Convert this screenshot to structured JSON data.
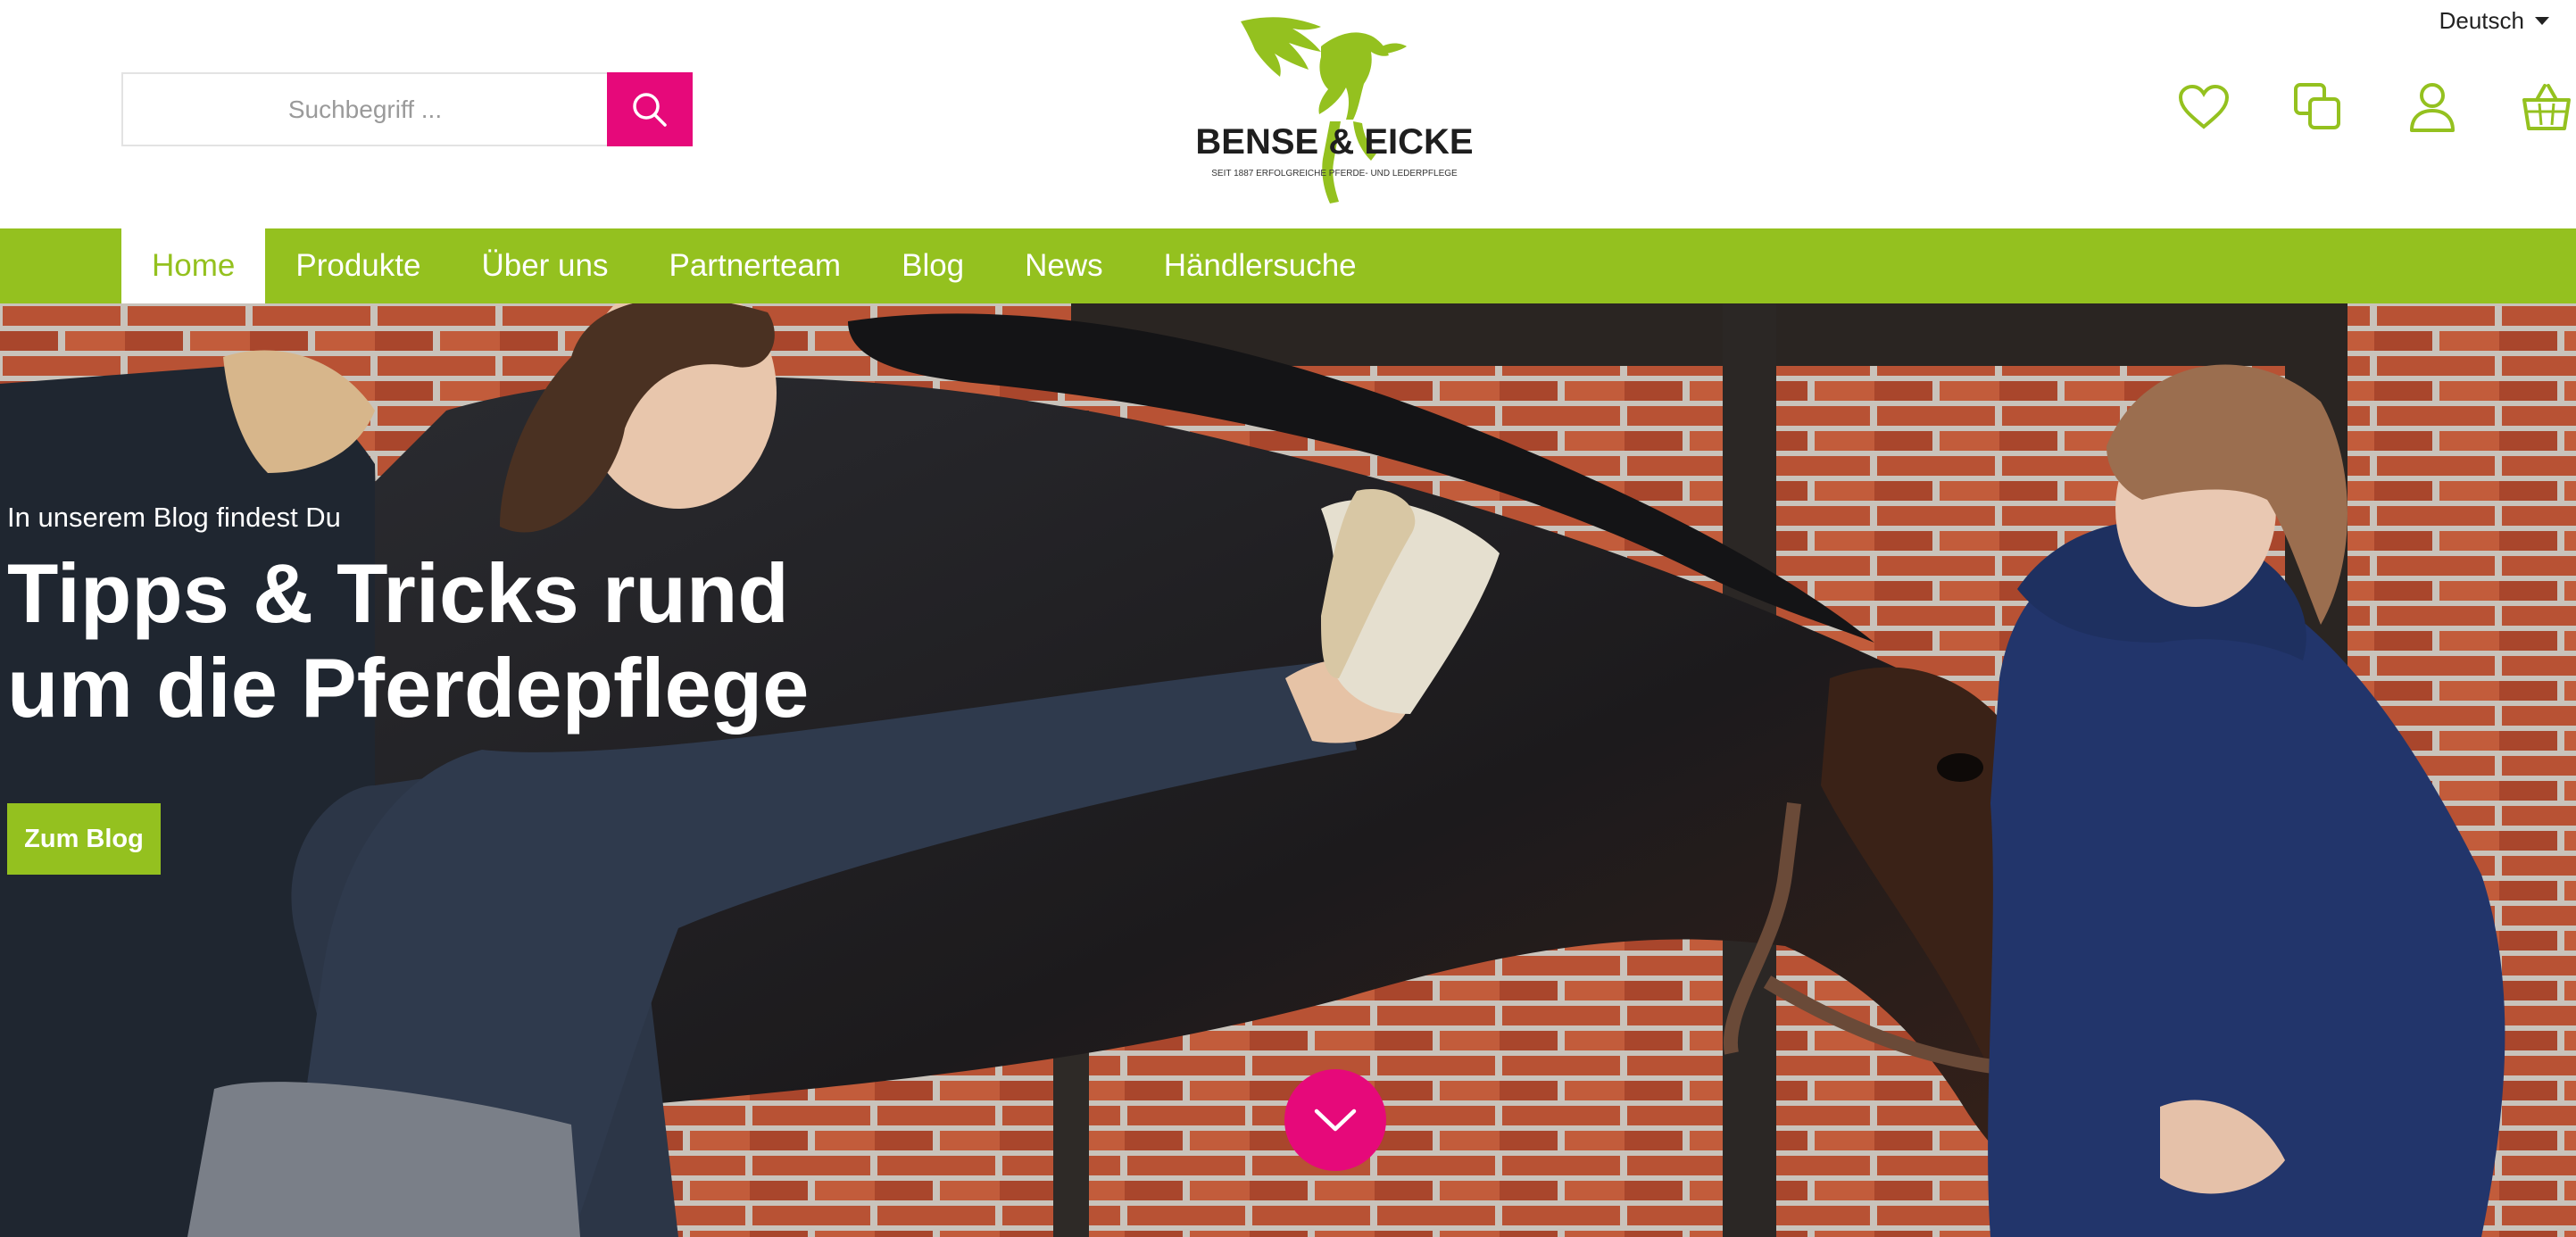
{
  "header": {
    "language": "Deutsch",
    "search": {
      "placeholder": "Suchbegriff ...",
      "value": ""
    },
    "logo": {
      "brand": "BENSE & EICKE",
      "tagline": "SEIT 1887 ERFOLGREICHE PFERDE- UND LEDERPFLEGE"
    },
    "icons": [
      "heart-icon",
      "compare-icon",
      "user-icon",
      "basket-icon"
    ]
  },
  "nav": {
    "items": [
      {
        "label": "Home",
        "active": true
      },
      {
        "label": "Produkte",
        "active": false
      },
      {
        "label": "Über uns",
        "active": false
      },
      {
        "label": "Partnerteam",
        "active": false
      },
      {
        "label": "Blog",
        "active": false
      },
      {
        "label": "News",
        "active": false
      },
      {
        "label": "Händlersuche",
        "active": false
      }
    ]
  },
  "hero": {
    "subtitle": "In unserem Blog findest Du",
    "title": "Tipps & Tricks rund um die Pferdepflege",
    "button": "Zum Blog"
  },
  "colors": {
    "brand_green": "#94c11f",
    "accent_pink": "#e6097a"
  }
}
